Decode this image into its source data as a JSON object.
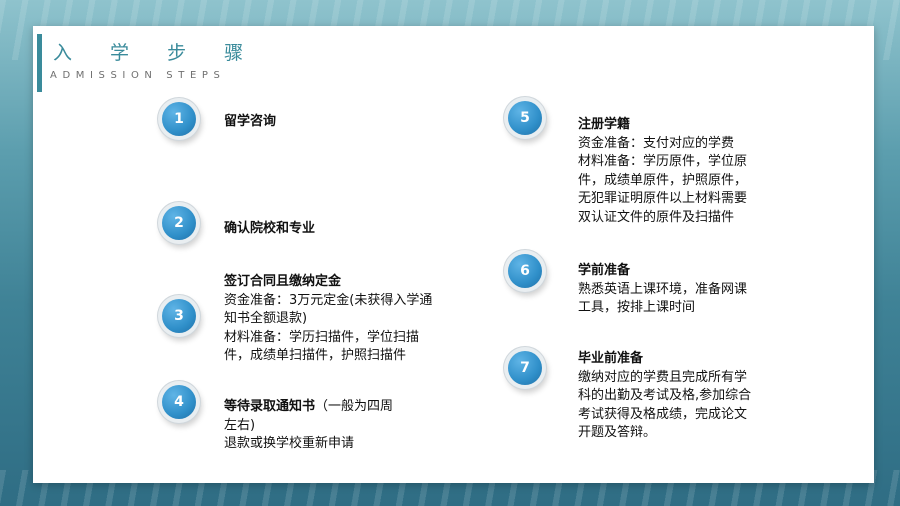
{
  "header": {
    "title": "入 学 步 骤",
    "subtitle": "ADMISSION STEPS"
  },
  "steps": [
    {
      "number": "1",
      "heading": "留学咨询",
      "lines": []
    },
    {
      "number": "2",
      "heading": "确认院校和专业",
      "lines": []
    },
    {
      "number": "3",
      "heading": "签订合同且缴纳定金",
      "lines": [
        "资金准备：3万元定金(未获得入学通知书全额退款)",
        "材料准备：学历扫描件，学位扫描件，成绩单扫描件，护照扫描件"
      ]
    },
    {
      "number": "4",
      "heading": "等待录取通知书",
      "heading_suffix": "（一般为四周左右)",
      "lines": [
        "退款或换学校重新申请"
      ]
    },
    {
      "number": "5",
      "heading": "注册学籍",
      "lines": [
        "资金准备：支付对应的学费",
        "材料准备：学历原件，学位原件，成绩单原件，护照原件，无犯罪证明原件以上材料需要双认证文件的原件及扫描件"
      ]
    },
    {
      "number": "6",
      "heading": "学前准备",
      "lines": [
        "熟悉英语上课环境，准备网课工具，按排上课时间"
      ]
    },
    {
      "number": "7",
      "heading": "毕业前准备",
      "lines": [
        "缴纳对应的学费且完成所有学科的出勤及考试及格,参加综合考试获得及格成绩，完成论文开题及答辩。"
      ]
    }
  ],
  "colors": {
    "accent": "#3a8b9b",
    "circle": "#2f8fc9",
    "background": "#5c9eae"
  }
}
